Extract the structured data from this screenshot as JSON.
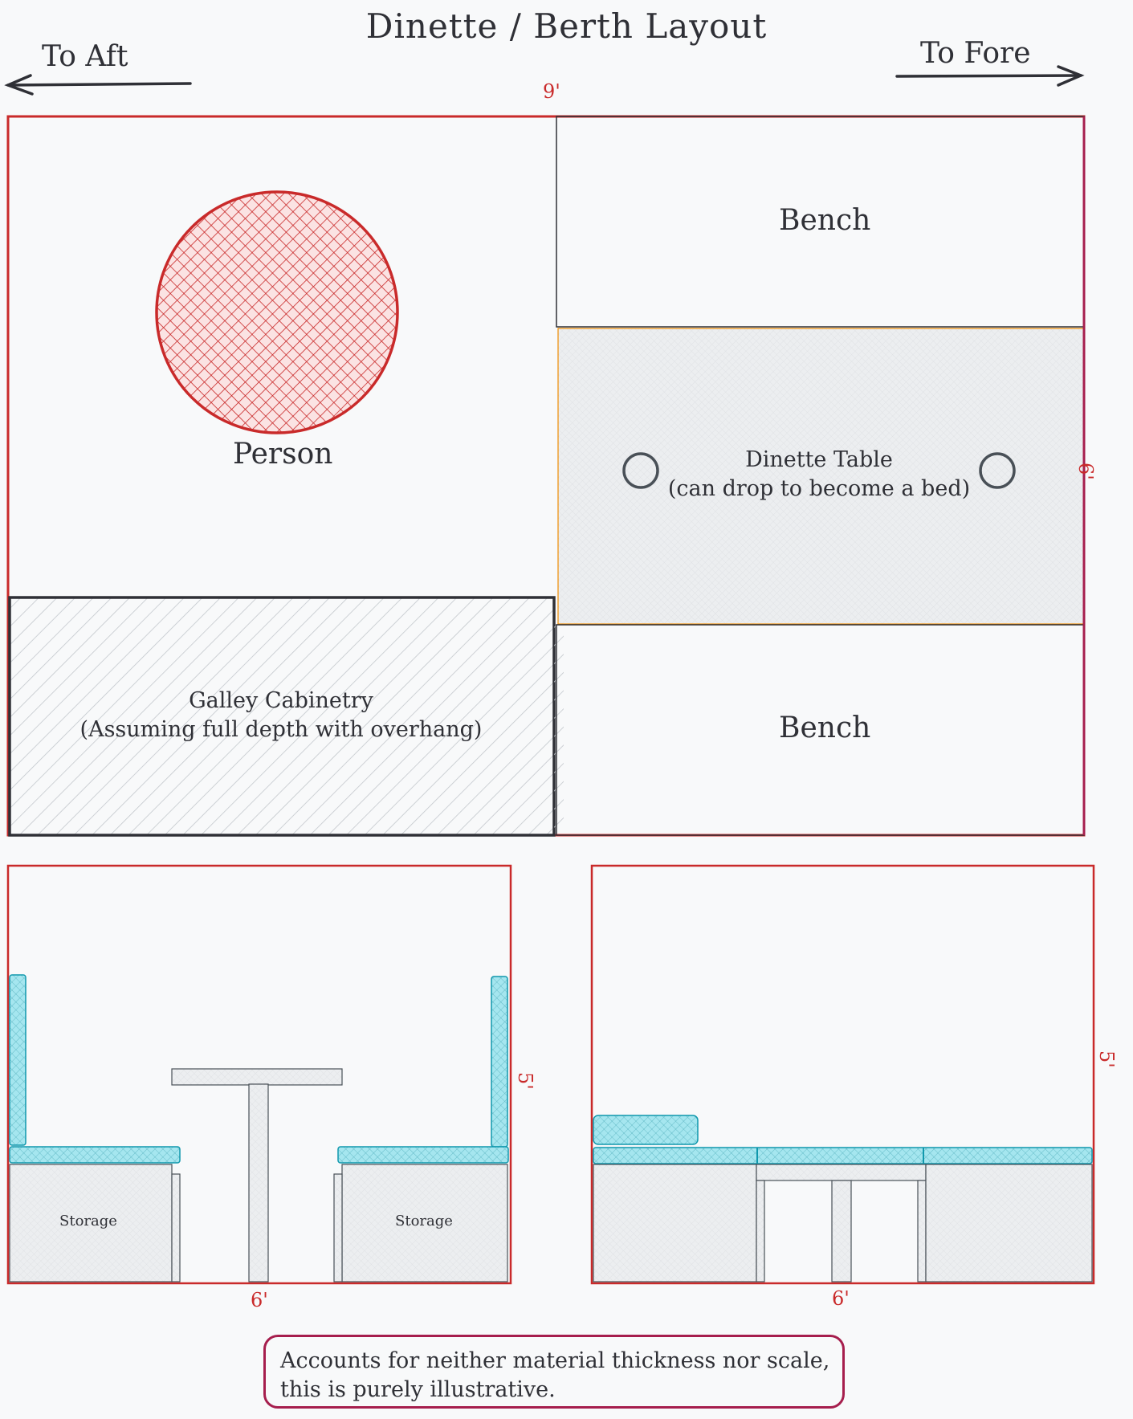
{
  "title": "Dinette / Berth Layout",
  "directions": {
    "aft": "To Aft",
    "fore": "To Fore"
  },
  "dimensions": {
    "plan_width": "9'",
    "plan_depth": "6'",
    "left_elev_height": "5'",
    "left_elev_width": "6'",
    "right_elev_height": "5'",
    "right_elev_width": "6'"
  },
  "labels": {
    "person": "Person",
    "bench_top": "Bench",
    "bench_bottom": "Bench",
    "table_line1": "Dinette Table",
    "table_line2": "(can drop to become a bed)",
    "galley_line1": "Galley Cabinetry",
    "galley_line2": "(Assuming full depth with overhang)",
    "storage_left": "Storage",
    "storage_right": "Storage"
  },
  "note": "Accounts for neither material thickness nor scale, this is purely illustrative.",
  "colors": {
    "outline_red": "#c92a2a",
    "stroke_dark": "#2f3036",
    "cushion_teal": "#99e9f2",
    "note_border": "#a61e4d"
  }
}
